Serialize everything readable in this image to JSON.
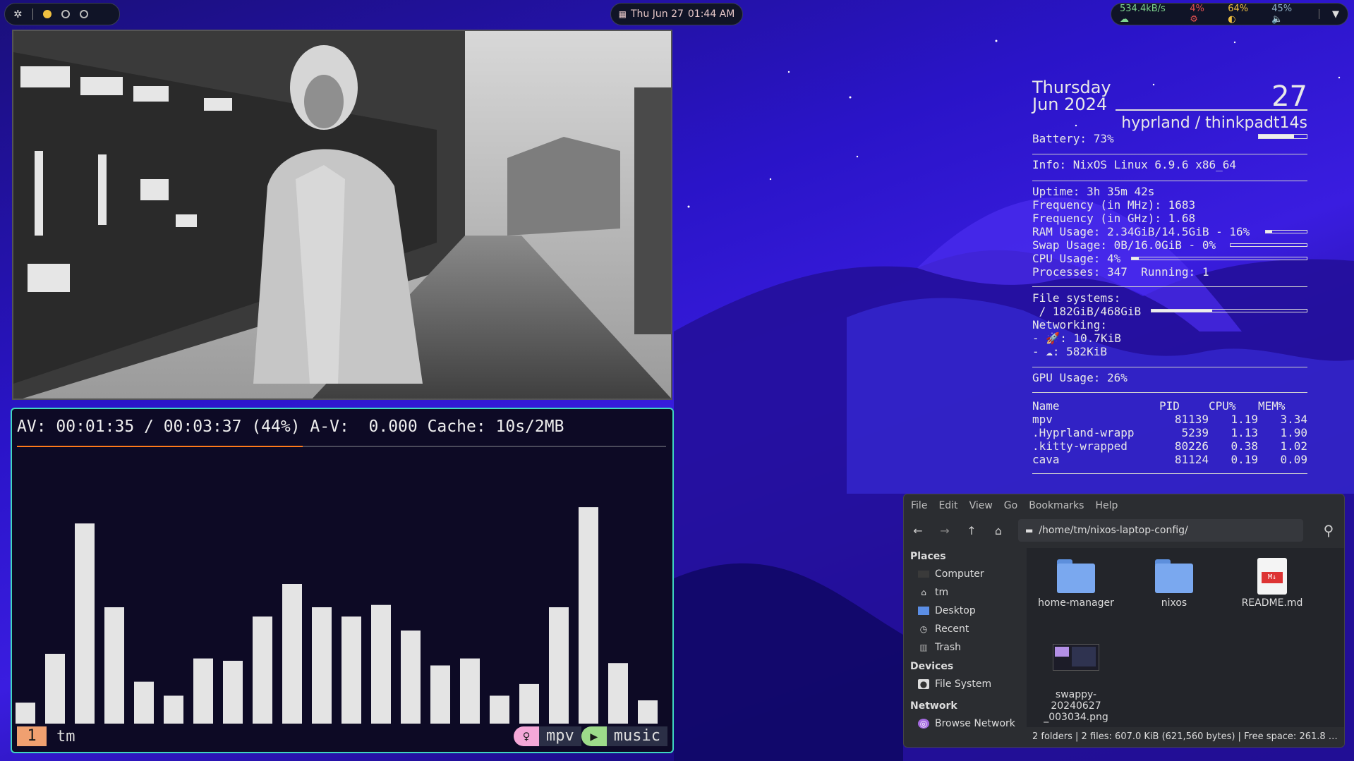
{
  "topbar": {
    "date": "Thu Jun 27",
    "time": "01:44 AM",
    "net_speed": "534.4kB/s",
    "cpu": "4%",
    "battery": "64%",
    "volume": "45%"
  },
  "terminal": {
    "mpv_status": "AV: 00:01:35 / 00:03:37 (44%) A-V:  0.000 Cache: 10s/2MB",
    "progress_fraction": 0.44,
    "cava_levels": [
      0.09,
      0.3,
      0.86,
      0.5,
      0.18,
      0.12,
      0.28,
      0.27,
      0.46,
      0.6,
      0.5,
      0.46,
      0.51,
      0.4,
      0.25,
      0.28,
      0.12,
      0.17,
      0.5,
      0.93,
      0.26,
      0.1
    ],
    "tmux": {
      "window_num": "1",
      "session": "tm",
      "pane1": "mpv",
      "pane2": "music"
    }
  },
  "conky": {
    "day_name": "Thursday",
    "month": "Jun",
    "year": "2024",
    "day_num": "27",
    "host": "hyprland / thinkpadt14s",
    "battery": "Battery: 73%",
    "battery_level": 0.73,
    "info": "Info: NixOS Linux 6.9.6 x86_64",
    "uptime": "Uptime: 3h 35m 42s",
    "freq_mhz": "Frequency (in MHz): 1683",
    "freq_ghz": "Frequency (in GHz): 1.68",
    "ram": "RAM Usage: 2.34GiB/14.5GiB - 16%",
    "ram_level": 0.16,
    "swap": "Swap Usage: 0B/16.0GiB - 0%",
    "swap_level": 0.0,
    "cpu": "CPU Usage: 4%",
    "cpu_level": 0.04,
    "processes": "Processes: 347  Running: 1",
    "fs_header": "File systems:",
    "fs_root": " / 182GiB/468GiB",
    "fs_level": 0.39,
    "net_header": "Networking:",
    "net_up": "- 🚀: 10.7KiB",
    "net_down": "- ☁: 582KiB",
    "gpu": "GPU Usage: 26%",
    "proc_headers": [
      "Name",
      "PID",
      "CPU%",
      "MEM%"
    ],
    "procs": [
      [
        " mpv",
        "81139",
        "1.19",
        "3.34"
      ],
      [
        " .Hyprland-wrapp",
        "5239",
        "1.13",
        "1.90"
      ],
      [
        " .kitty-wrapped",
        "80226",
        "0.38",
        "1.02"
      ],
      [
        " cava",
        "81124",
        "0.19",
        "0.09"
      ]
    ]
  },
  "file_manager": {
    "menu": [
      "File",
      "Edit",
      "View",
      "Go",
      "Bookmarks",
      "Help"
    ],
    "path": "/home/tm/nixos-laptop-config/",
    "places_header": "Places",
    "places": [
      "Computer",
      "tm",
      "Desktop",
      "Recent",
      "Trash"
    ],
    "devices_header": "Devices",
    "devices": [
      "File System"
    ],
    "network_header": "Network",
    "network": [
      "Browse Network"
    ],
    "files": [
      {
        "name": "home-manager",
        "type": "folder"
      },
      {
        "name": "nixos",
        "type": "folder"
      },
      {
        "name": "README.md",
        "type": "markdown"
      },
      {
        "name": "swappy-20240627\n_003034.png",
        "type": "image"
      }
    ],
    "status": "2 folders  |  2 files: 607.0 KiB (621,560 bytes)  |  Free space: 261.8 …"
  }
}
